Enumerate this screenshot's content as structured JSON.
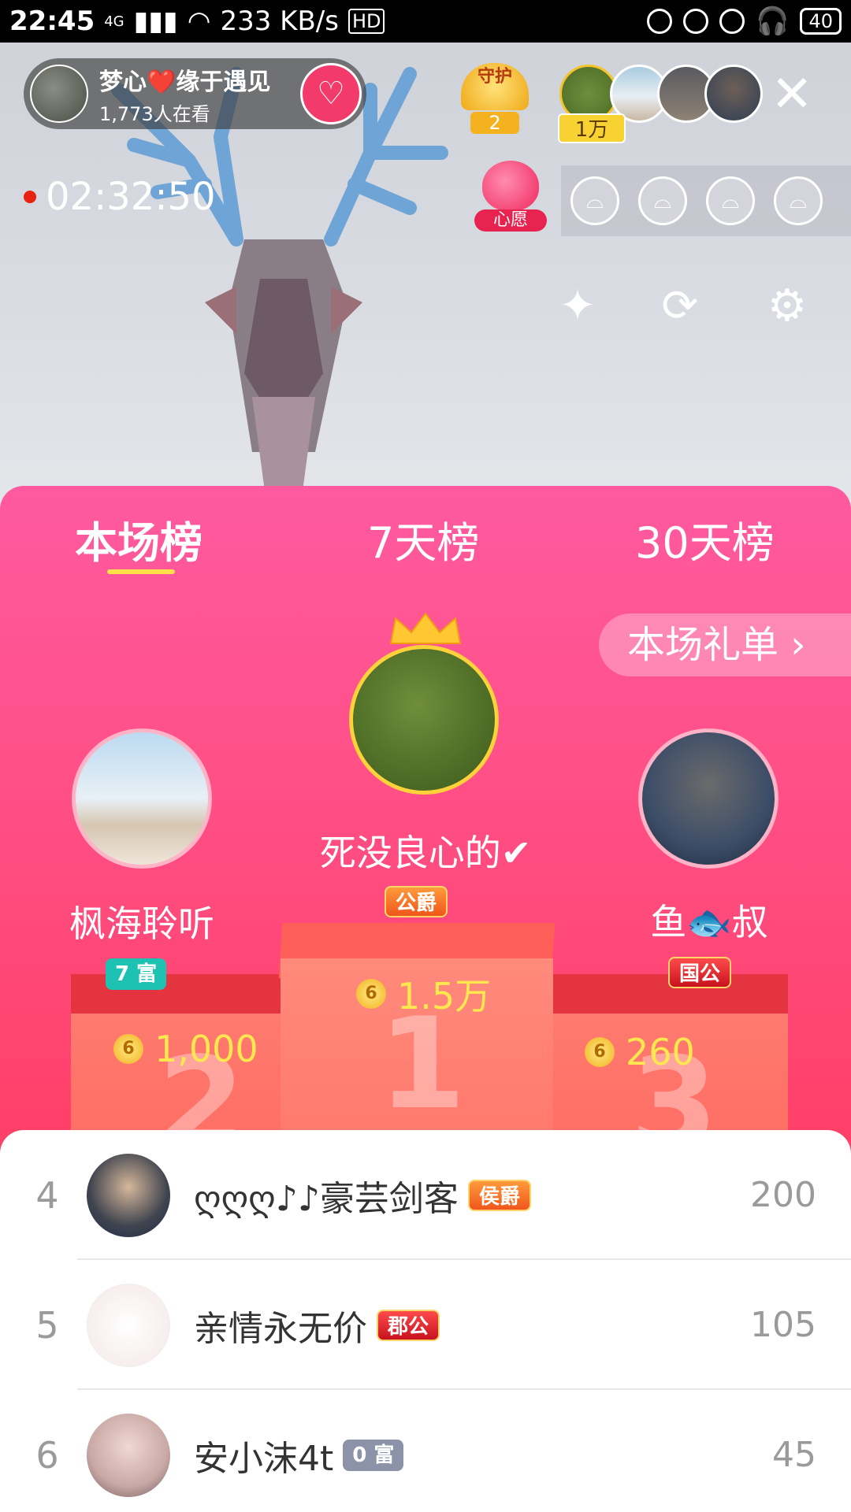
{
  "status_bar": {
    "time": "22:45",
    "network": "4G",
    "speed": "233 KB/s",
    "hd": "HD",
    "battery": "40"
  },
  "live": {
    "host_name": "梦心❤️缘于遇见",
    "viewers": "1,773人在看",
    "guard_label": "守护",
    "guard_count": "2",
    "top_value": "1万",
    "timer": "02:32:50",
    "wish_label": "心愿"
  },
  "ranking": {
    "tabs": [
      "本场榜",
      "7天榜",
      "30天榜"
    ],
    "gift_link": "本场礼单 ›",
    "podium": [
      {
        "rank": "1",
        "name": "死没良心的✔",
        "badge": "公爵",
        "score": "1.5万"
      },
      {
        "rank": "2",
        "name": "枫海聆听",
        "badge": "7 富",
        "score": "1,000"
      },
      {
        "rank": "3",
        "name": "鱼🐟叔",
        "badge": "国公",
        "score": "260"
      }
    ],
    "list": [
      {
        "rank": "4",
        "name": "ღღღ♪♪豪芸剑客",
        "badge": "侯爵",
        "score": "200"
      },
      {
        "rank": "5",
        "name": "亲情永无价",
        "badge": "郡公",
        "score": "105"
      },
      {
        "rank": "6",
        "name": "安小沫4t",
        "badge": "0 富",
        "score": "45"
      }
    ]
  },
  "colors": {
    "sheet_pink": "#ff5aa0",
    "accent_yellow": "#ffe74f",
    "follow_red": "#f23b6b"
  }
}
